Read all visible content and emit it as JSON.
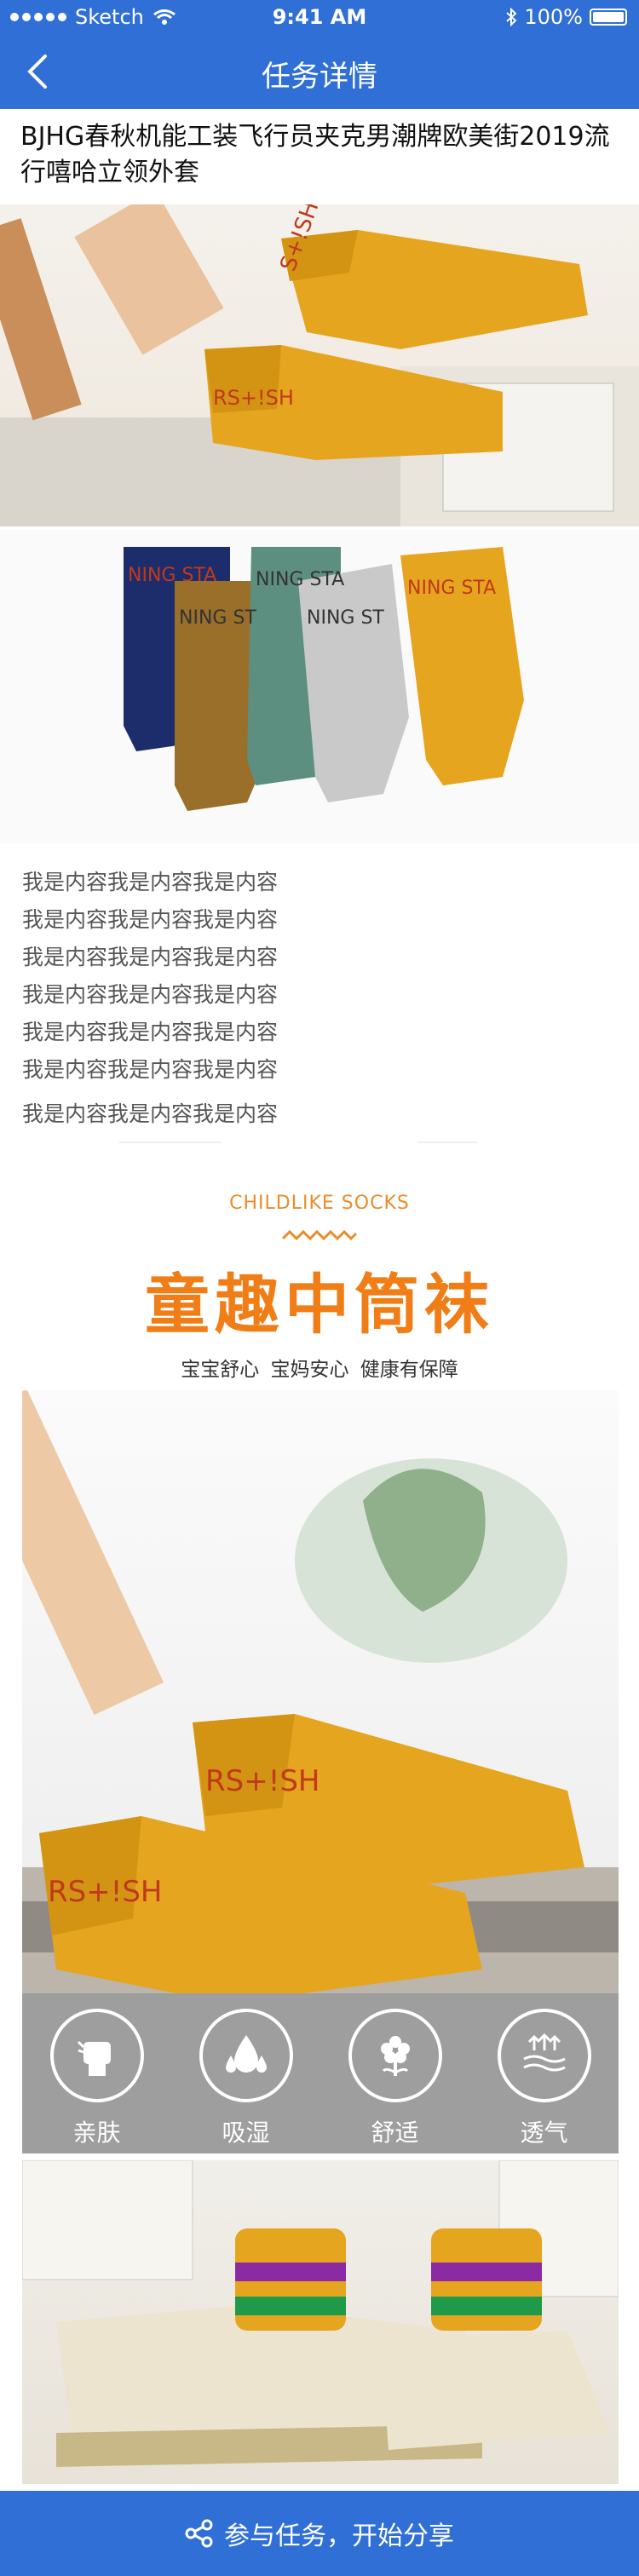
{
  "status": {
    "carrier": "Sketch",
    "time": "9:41 AM",
    "battery": "100%"
  },
  "nav": {
    "title": "任务详情"
  },
  "product": {
    "title": "BJHG春秋机能工装飞行员夹克男潮牌欧美街2019流行嘻哈立领外套"
  },
  "content_lines": [
    "我是内容我是内容我是内容",
    "我是内容我是内容我是内容",
    "我是内容我是内容我是内容",
    "我是内容我是内容我是内容",
    "我是内容我是内容我是内容",
    "我是内容我是内容我是内容",
    "我是内容我是内容我是内容"
  ],
  "banner": {
    "subtitle": "CHILDLIKE SOCKS",
    "title": "童趣中筒袜",
    "tagline": "宝宝舒心 宝妈安心 健康有保障"
  },
  "features": [
    {
      "icon": "fist-icon",
      "label": "亲肤"
    },
    {
      "icon": "water-drops-icon",
      "label": "吸湿"
    },
    {
      "icon": "flower-icon",
      "label": "舒适"
    },
    {
      "icon": "airflow-icon",
      "label": "透气"
    }
  ],
  "cta": {
    "label": "参与任务，开始分享",
    "icon": "share-icon"
  },
  "colors": {
    "primary": "#2f6fd6",
    "accent_orange": "#f07d16",
    "sock_yellow": "#e6a51e"
  }
}
